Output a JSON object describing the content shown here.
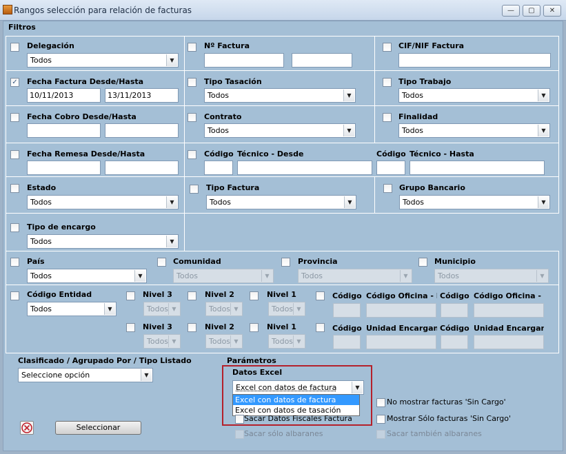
{
  "window": {
    "title": "Rangos selección para relación de facturas",
    "min": "▭",
    "max": "□",
    "close": "✕"
  },
  "filtros_label": "Filtros",
  "delegacion": {
    "label": "Delegación",
    "value": "Todos"
  },
  "nfactura": {
    "label": "Nº Factura"
  },
  "cif": {
    "label": "CIF/NIF Factura"
  },
  "fecha_factura": {
    "label": "Fecha Factura Desde/Hasta",
    "desde": "10/11/2013",
    "hasta": "13/11/2013",
    "checked": "✓"
  },
  "tipo_tasacion": {
    "label": "Tipo Tasación",
    "value": "Todos"
  },
  "tipo_trabajo": {
    "label": "Tipo Trabajo",
    "value": "Todos"
  },
  "fecha_cobro": {
    "label": "Fecha Cobro Desde/Hasta"
  },
  "contrato": {
    "label": "Contrato",
    "value": "Todos"
  },
  "finalidad": {
    "label": "Finalidad",
    "value": "Todos"
  },
  "fecha_remesa": {
    "label": "Fecha Remesa Desde/Hasta"
  },
  "tecnico": {
    "codigo1": "Código",
    "desde": "Técnico - Desde",
    "codigo2": "Código",
    "hasta": "Técnico - Hasta"
  },
  "estado": {
    "label": "Estado",
    "value": "Todos"
  },
  "tipo_factura": {
    "label": "Tipo Factura",
    "value": "Todos"
  },
  "grupo_bancario": {
    "label": "Grupo Bancario",
    "value": "Todos"
  },
  "tipo_encargo": {
    "label": "Tipo de encargo",
    "value": "Todos"
  },
  "pais": {
    "label": "País",
    "value": "Todos"
  },
  "comunidad": {
    "label": "Comunidad",
    "value": "Todos"
  },
  "provincia": {
    "label": "Provincia",
    "value": "Todos"
  },
  "municipio": {
    "label": "Municipio",
    "value": "Todos"
  },
  "codigo_entidad": {
    "label": "Código Entidad",
    "value": "Todos"
  },
  "nivel3": "Nivel 3",
  "nivel2": "Nivel 2",
  "nivel1": "Nivel 1",
  "todos": "Todos",
  "codigo": "Código",
  "codigo_oficina_de": "Código Oficina - De",
  "codigo_oficina_ha": "Código Oficina - Ha",
  "unidad_encargante": "Unidad Encargante",
  "clasificado": {
    "label": "Clasificado / Agrupado Por / Tipo Listado",
    "value": "Seleccione opción"
  },
  "parametros": "Parámetros",
  "datos_excel": {
    "label": "Datos Excel",
    "value": "Excel con datos de factura",
    "options": [
      "Excel con datos de factura",
      "Excel con datos de tasación"
    ]
  },
  "opts": {
    "no_mostrar": "No mostrar facturas 'Sin Cargo'",
    "sacar_fiscales": "Sacar Datos Fiscales Factura",
    "mostrar_solo": "Mostrar Sólo facturas 'Sin Cargo'",
    "sacar_albaranes": "Sacar sólo albaranes",
    "sacar_tambien": "Sacar también albaranes"
  },
  "seleccionar": "Seleccionar",
  "colors": {
    "panel": "#a4bfd6",
    "accent": "#b4202a",
    "highlight": "#3399ff"
  }
}
